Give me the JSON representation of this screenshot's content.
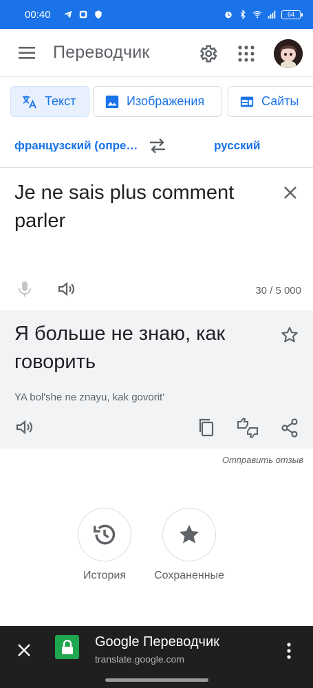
{
  "status_bar": {
    "time": "00:40",
    "battery": "64",
    "icons": [
      "telegram-icon",
      "app-icon",
      "shield-icon",
      "alarm-icon",
      "bluetooth-icon",
      "wifi-icon",
      "signal-icon",
      "battery-icon"
    ]
  },
  "header": {
    "title": "Переводчик",
    "icons": [
      "menu-icon",
      "settings-icon",
      "apps-grid-icon"
    ]
  },
  "modes": [
    {
      "label": "Текст",
      "icon": "translate-icon",
      "active": true
    },
    {
      "label": "Изображения",
      "icon": "image-icon",
      "active": false
    },
    {
      "label": "Сайты",
      "icon": "web-icon",
      "active": false
    }
  ],
  "languages": {
    "source": "французский (опре…",
    "target": "русский"
  },
  "input": {
    "text": "Je ne sais plus comment parler",
    "char_count": "30 / 5 000"
  },
  "output": {
    "text": "Я больше не знаю, как говорить",
    "transliteration": "YA bol'she ne znayu, kak govorit'"
  },
  "send_feedback": "Отправить отзыв",
  "shortcuts": [
    {
      "label": "История",
      "icon": "history-icon"
    },
    {
      "label": "Сохраненные",
      "icon": "star-icon"
    }
  ],
  "custom_tab": {
    "title": "Google Переводчик",
    "url": "translate.google.com"
  },
  "colors": {
    "accent": "#1a73e8",
    "status_bar": "#1a73e8",
    "output_bg": "#f1f3f4",
    "tab_bar": "#1f1f1f",
    "lock_green": "#1fa750"
  }
}
